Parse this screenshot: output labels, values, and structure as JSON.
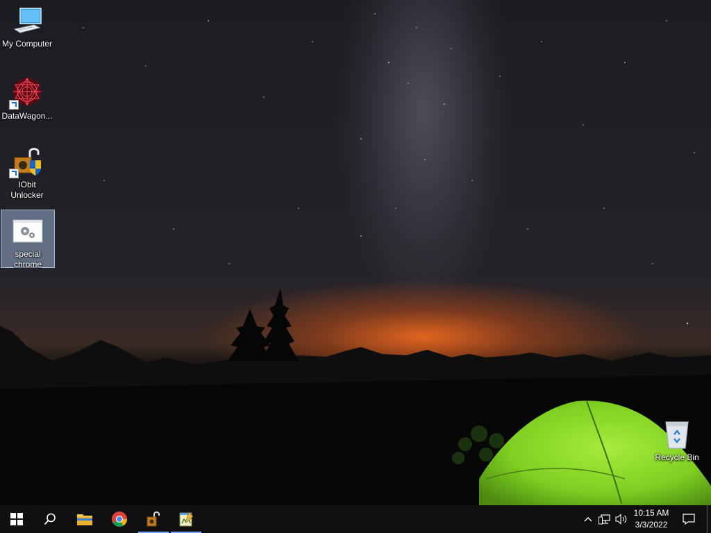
{
  "desktop": {
    "icons": [
      {
        "label": "My Computer",
        "icon": "computer-icon"
      },
      {
        "label": "DataWagon...",
        "icon": "datawagon-icon"
      },
      {
        "label": "IObit Unlocker",
        "icon": "iobit-unlocker-icon"
      },
      {
        "label": "special chrome",
        "icon": "settings-window-icon",
        "selected": true
      }
    ],
    "recycle_bin": {
      "label": "Recycle Bin",
      "icon": "recycle-bin-icon"
    }
  },
  "taskbar": {
    "start": {
      "icon": "windows-logo-icon"
    },
    "search": {
      "icon": "search-icon"
    },
    "pinned": [
      {
        "name": "File Explorer",
        "icon": "folder-icon"
      },
      {
        "name": "Google Chrome",
        "icon": "chrome-icon"
      },
      {
        "name": "IObit Unlocker",
        "icon": "unlocker-icon",
        "active": true
      },
      {
        "name": "Notepad App",
        "icon": "notepad-icon",
        "active": true
      }
    ],
    "tray": {
      "chevron_icon": "chevron-up-icon",
      "network_icon": "network-icon",
      "volume_icon": "volume-icon",
      "notifications_icon": "notification-icon"
    },
    "clock": {
      "time": "10:15 AM",
      "date": "3/3/2022"
    }
  },
  "colors": {
    "taskbar": "#101012",
    "active_indicator": "#7aa7ff",
    "selection": "#96afcd",
    "tent_green": "#8fd82a",
    "horizon_orange": "#ff6e1e"
  }
}
